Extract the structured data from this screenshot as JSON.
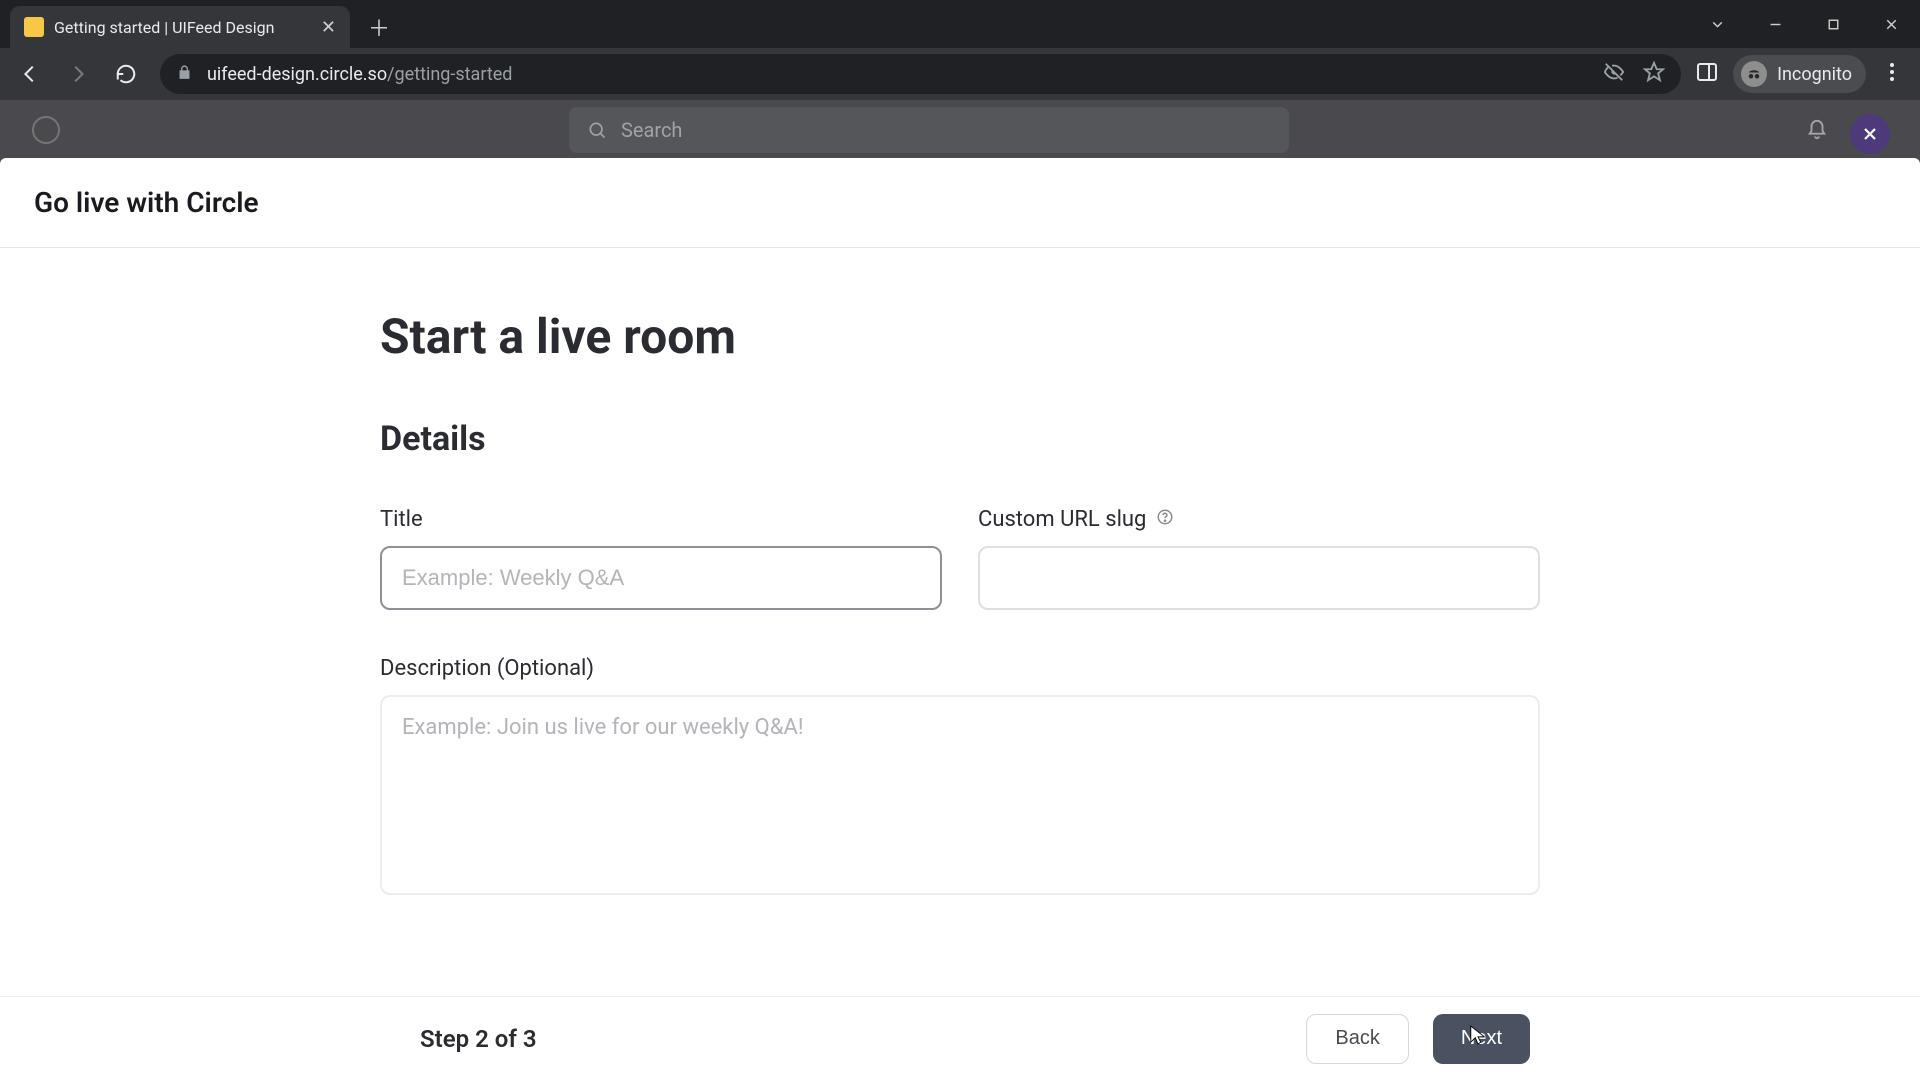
{
  "browser": {
    "tab_title": "Getting started | UIFeed Design",
    "url_host": "uifeed-design.circle.so",
    "url_path": "/getting-started",
    "incognito_label": "Incognito"
  },
  "app_background": {
    "search_placeholder": "Search"
  },
  "modal": {
    "title": "Go live with Circle",
    "heading": "Start a live room",
    "section_title": "Details",
    "fields": {
      "title": {
        "label": "Title",
        "placeholder": "Example: Weekly Q&A",
        "value": ""
      },
      "slug": {
        "label": "Custom URL slug",
        "value": ""
      },
      "description": {
        "label": "Description (Optional)",
        "placeholder": "Example: Join us live for our weekly Q&A!",
        "value": ""
      }
    },
    "footer": {
      "step_text": "Step 2 of 3",
      "back_label": "Back",
      "next_label": "Next"
    }
  }
}
